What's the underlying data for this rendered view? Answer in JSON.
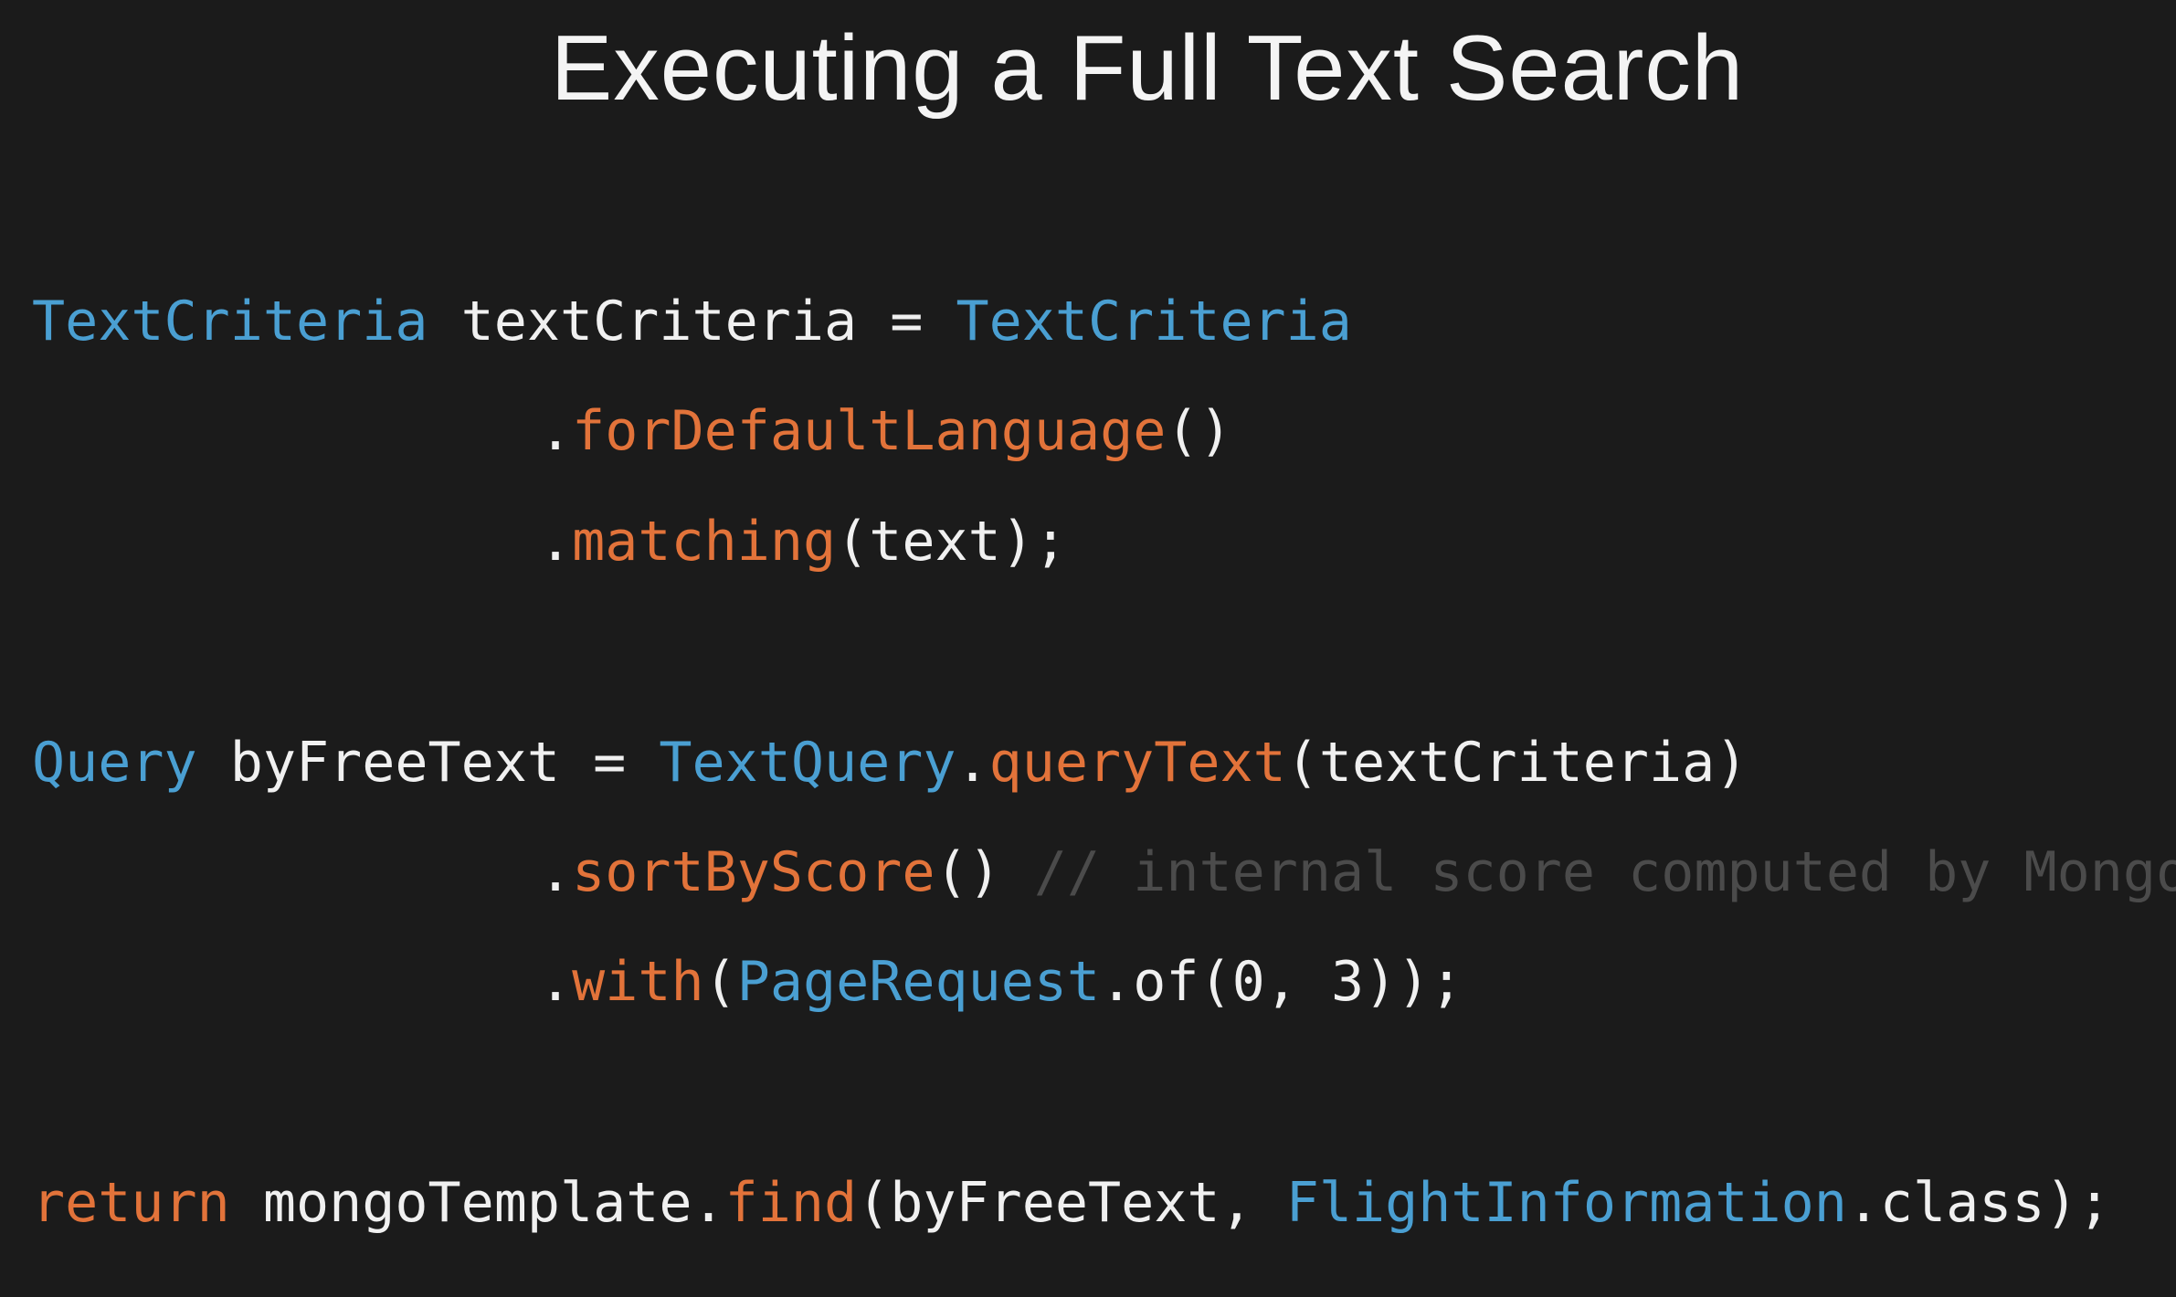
{
  "slide": {
    "title": "Executing a Full Text Search"
  },
  "code": {
    "line1": {
      "type1": "TextCriteria",
      "var": " textCriteria = ",
      "type2": "TextCriteria"
    },
    "line2": {
      "dot": ".",
      "method": "forDefaultLanguage",
      "rest": "()"
    },
    "line3": {
      "dot": ".",
      "method": "matching",
      "rest": "(text);"
    },
    "line4": {
      "type1": "Query",
      "var": " byFreeText = ",
      "type2": "TextQuery",
      "dot": ".",
      "method": "queryText",
      "rest": "(textCriteria)"
    },
    "line5": {
      "dot": ".",
      "method": "sortByScore",
      "rest": "() ",
      "comment": "// internal score computed by Mongo"
    },
    "line6": {
      "dot": ".",
      "method": "with",
      "open": "(",
      "type": "PageRequest",
      "rest": ".of(0, 3));"
    },
    "line7": {
      "keyword": "return",
      "var": " mongoTemplate.",
      "method": "find",
      "args": "(byFreeText, ",
      "type": "FlightInformation",
      "rest": ".class);"
    }
  },
  "colors": {
    "background": "#1b1b1b",
    "type": "#4a9fd2",
    "method": "#e2733a",
    "plain": "#f0f0f0",
    "comment": "#4b4b4b"
  }
}
